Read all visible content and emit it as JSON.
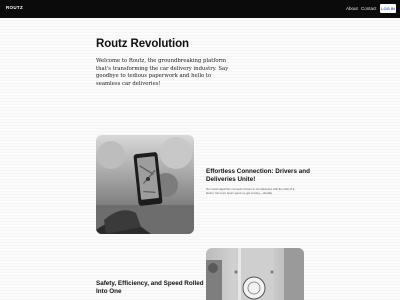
{
  "navbar": {
    "brand": "ROUTZ",
    "links": [
      "About",
      "Contact"
    ],
    "login_label": "LOG IN"
  },
  "hero": {
    "title": "Routz Revolution",
    "text": "Welcome to Routz, the groundbreaking platform that's transforming the car delivery industry. Say goodbye to tedious paperwork and hello to seamless car deliveries!"
  },
  "features": [
    {
      "title": "Effortless Connection: Drivers and Deliveries Unite!",
      "description": "Our smart algorithm connects drivers to car deliveries with the click of a button. No more hours spent on get moving.—literally.",
      "image_icon": "phone-map-photo"
    },
    {
      "title": "Safety, Efficiency, and Speed Rolled Into One",
      "image_icon": "street-sign-photo"
    }
  ]
}
